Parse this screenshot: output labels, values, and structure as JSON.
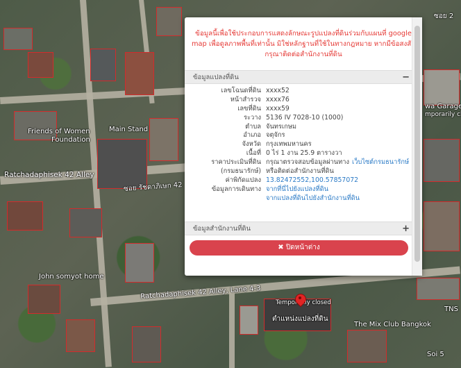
{
  "map": {
    "labels": {
      "friends": "Friends of Women",
      "foundation": "Foundation",
      "main_stand": "Main Stand",
      "alley42": "Ratchadaphisek 42 Alley",
      "soi_thai": "ซอย รัชดาภิเษก 42",
      "john_home": "John somyot home",
      "lane": "Ratchadaphisek 42 Alley, Lane 4-3",
      "garage": "wa Garage",
      "closed_right": "mporarily close",
      "mix_club": "The Mix Club Bangkok",
      "soi5": "Soi 5",
      "temp_closed": "Temporarily closed",
      "pin_label": "ตำแหน่งแปลงที่ดิน",
      "top_right": "ซอย 2",
      "bottom_right": "TNS"
    }
  },
  "popup": {
    "close": "×",
    "notice": "ข้อมูลนี้เพื่อใช้ประกอบการแสดงลักษณะรูปแปลงที่ดินร่วมกับแผนที่ google map เพื่อดูลภาพพื้นที่เท่านั้น มิใช่หลักฐานที่ใช้ในทางกฎหมาย หากมีข้อสงสัย กรุณาติดต่อสำนักงานที่ดิน",
    "section1": {
      "title": "ข้อมูลแปลงที่ดิน",
      "toggle": "−"
    },
    "section2": {
      "title": "ข้อมูลสำนักงานที่ดิน",
      "toggle": "+"
    },
    "rows": [
      {
        "label": "เลขโฉนดที่ดิน",
        "value": "xxxx52"
      },
      {
        "label": "หน้าสำรวจ",
        "value": "xxxx76"
      },
      {
        "label": "เลขที่ดิน",
        "value": "xxxx59"
      },
      {
        "label": "ระวาง",
        "value": "5136 IV 7028-10 (1000)"
      },
      {
        "label": "ตำบล",
        "value": "จันทรเกษม"
      },
      {
        "label": "อำเภอ",
        "value": "จตุจักร"
      },
      {
        "label": "จังหวัด",
        "value": "กรุงเทพมหานคร"
      },
      {
        "label": "เนื้อที่",
        "value": "0 ไร่ 1 งาน 25.9 ตารางวา"
      },
      {
        "label": "ราคาประเมินที่ดิน",
        "value": "กรุณาตรวจสอบข้อมูลผ่านทาง",
        "link": "เว็บไซต์กรมธนารักษ์"
      },
      {
        "label": "(กรมธนารักษ์)",
        "value": "หรือติดต่อสำนักงานที่ดิน"
      },
      {
        "label": "ค่าพิกัดแปลง",
        "link": "13.82472552,100.57857072"
      },
      {
        "label": "ข้อมูลการเดินทาง",
        "link": "จากที่นี่ไปยังแปลงที่ดิน"
      },
      {
        "label": "",
        "link": "จากแปลงที่ดินไปยังสำนักงานที่ดิน"
      }
    ],
    "close_button": "✖ ปิดหน้าต่าง"
  }
}
